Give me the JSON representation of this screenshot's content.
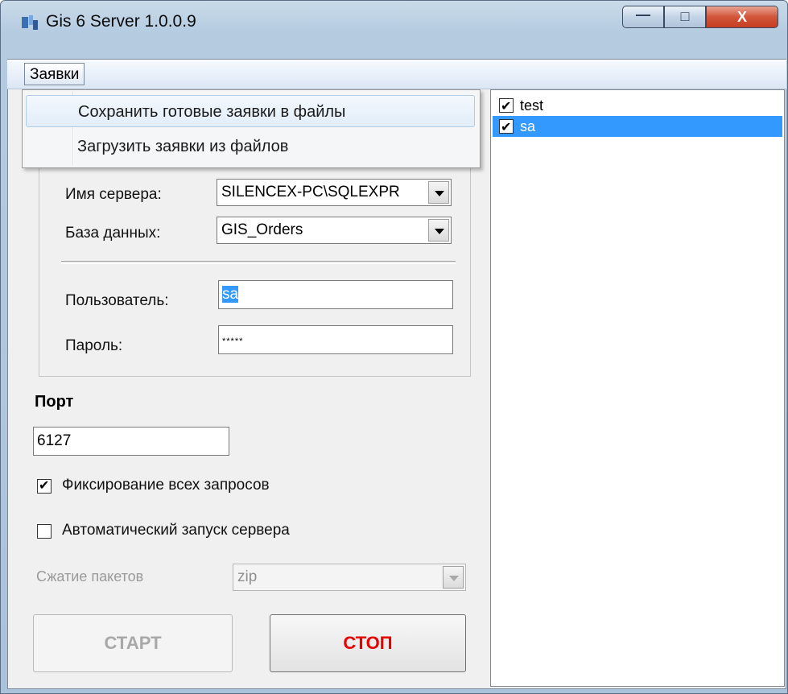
{
  "window": {
    "title": "Gis 6 Server 1.0.0.9",
    "minimize_glyph": "—",
    "maximize_glyph": "□",
    "close_glyph": "X"
  },
  "menu": {
    "label": "Заявки",
    "items": [
      {
        "label": "Сохранить готовые заявки в файлы"
      },
      {
        "label": "Загрузить заявки из файлов"
      }
    ]
  },
  "connection": {
    "server_label": "Имя сервера:",
    "server_value": "SILENCEX-PC\\SQLEXPR",
    "database_label": "База данных:",
    "database_value": "GIS_Orders",
    "user_label": "Пользователь:",
    "user_value": "sa",
    "password_label": "Пароль:",
    "password_value": "*****"
  },
  "port": {
    "title": "Порт",
    "value": "6127"
  },
  "options": {
    "log_all": {
      "label": "Фиксирование всех запросов",
      "checked": true
    },
    "autostart": {
      "label": "Автоматический запуск сервера",
      "checked": false
    },
    "compression_label": "Сжатие пакетов",
    "compression_value": "zip"
  },
  "buttons": {
    "start": "СТАРТ",
    "stop": "СТОП"
  },
  "users": [
    {
      "name": "test",
      "checked": true
    },
    {
      "name": "sa",
      "checked": true,
      "selected": true
    }
  ],
  "colors": {
    "selection": "#3399ff",
    "stop_text": "#e60000"
  }
}
